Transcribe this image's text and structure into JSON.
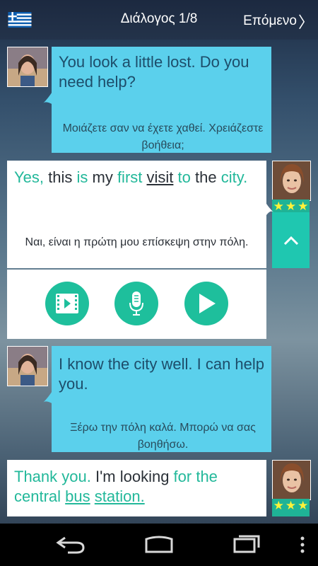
{
  "header": {
    "title": "Διάλογος 1/8",
    "next_label": "Επόμενο"
  },
  "messages": [
    {
      "side": "left",
      "english": "You look a little lost. Do you need help?",
      "greek": "Μοιάζετε σαν να έχετε χαθεί. Χρειάζεστε βοήθεια;"
    },
    {
      "side": "right",
      "english_words": [
        "Yes,",
        " this ",
        "is",
        " my ",
        "first",
        " ",
        "visit",
        " ",
        "to",
        " the",
        " city."
      ],
      "greek": "Ναι, είναι η πρώτη μου επίσκεψη στην πόλη.",
      "rating_stars": 3
    },
    {
      "side": "left",
      "english": "I know the city well. I can help you.",
      "greek": "Ξέρω την πόλη καλά. Μπορώ να σας βοηθήσω."
    },
    {
      "side": "right",
      "english_words": [
        "Thank you.",
        " I'm looking ",
        "for the",
        " central ",
        "bus",
        " ",
        "station."
      ],
      "rating_stars": 3
    }
  ],
  "controls": [
    "video-icon",
    "microphone-icon",
    "play-icon"
  ],
  "colors": {
    "bubble_blue": "#5bd0ec",
    "accent_green": "#1ebf9c",
    "highlight_text": "#22b89a",
    "star": "#fff23a"
  },
  "nav_buttons": [
    "back-icon",
    "home-icon",
    "recent-apps-icon"
  ]
}
